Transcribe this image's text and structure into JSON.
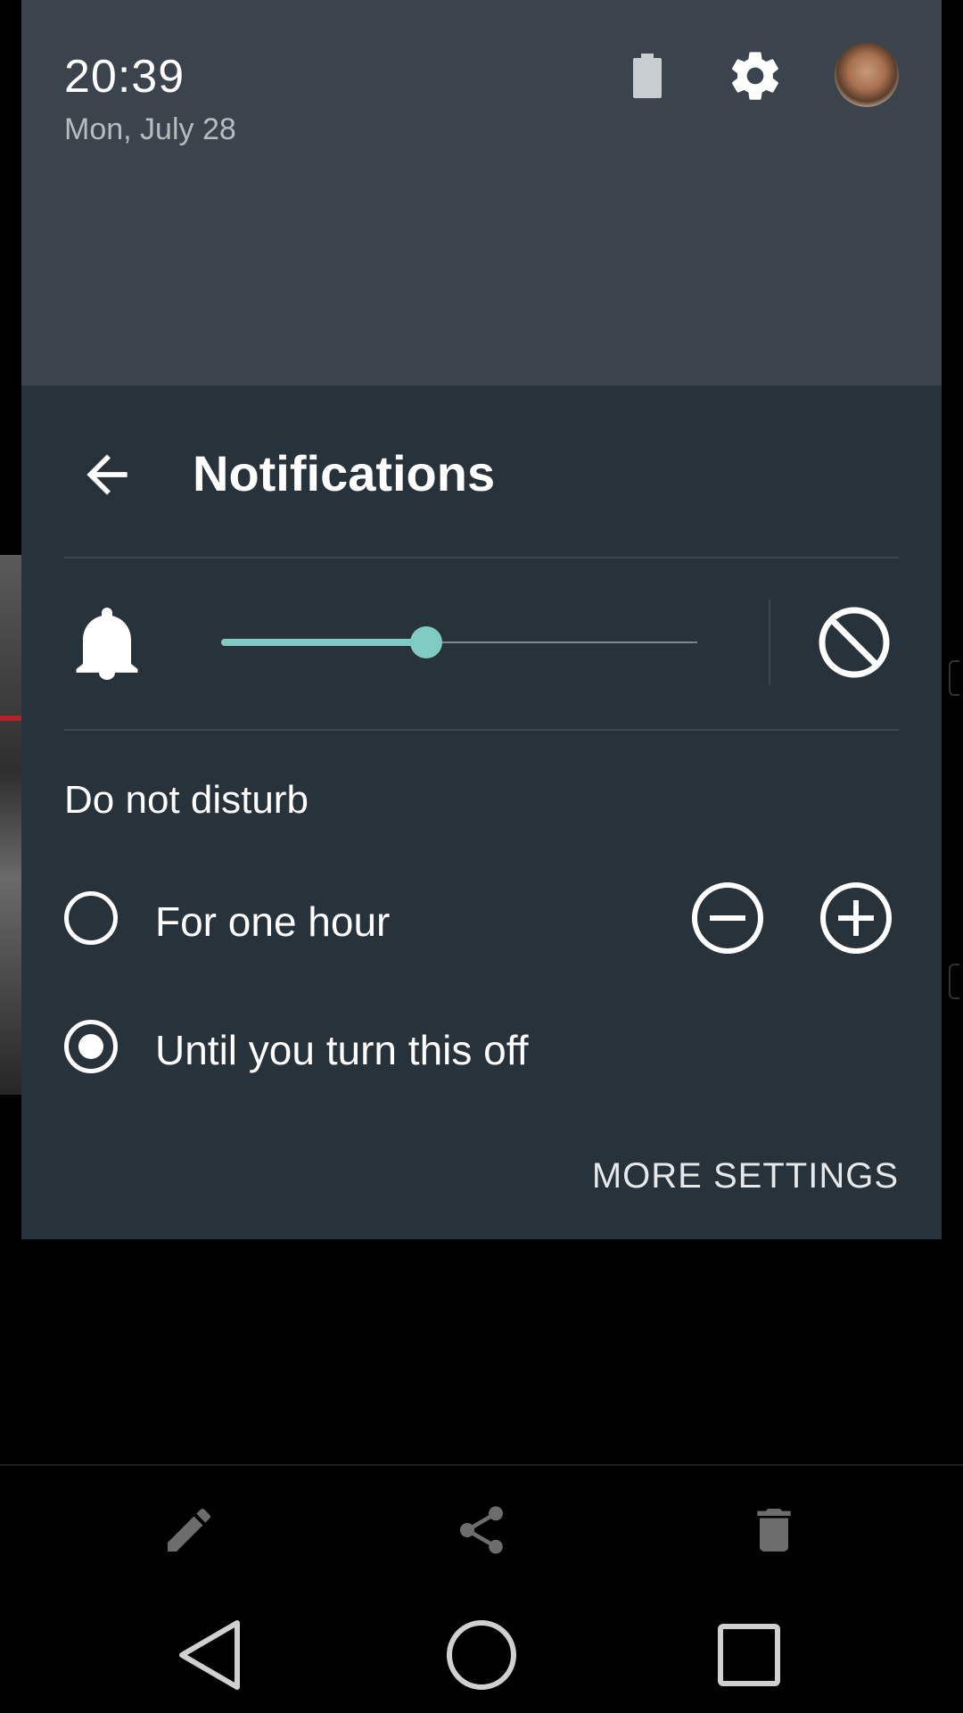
{
  "status_header": {
    "time": "20:39",
    "date": "Mon, July 28",
    "icons": [
      "battery-icon",
      "settings-gear-icon",
      "user-avatar"
    ]
  },
  "notifications_panel": {
    "title": "Notifications",
    "back_icon": "arrow-back-icon",
    "volume": {
      "icon": "bell-icon",
      "level": 0.43,
      "mute_icon": "block-icon"
    },
    "dnd": {
      "label": "Do not disturb",
      "options": [
        {
          "label": "For one hour",
          "selected": false
        },
        {
          "label": "Until you turn this off",
          "selected": true
        }
      ],
      "decrease_icon": "minus-circle-icon",
      "increase_icon": "plus-circle-icon"
    },
    "more_settings_label": "MORE SETTINGS"
  },
  "colors": {
    "header_bg": "#3b444c",
    "panel_bg": "#28323a",
    "accent": "#80cbc4"
  },
  "app_toolbar": {
    "icons": [
      "edit-pencil-icon",
      "share-icon",
      "delete-trash-icon"
    ]
  },
  "navigation_bar": {
    "icons": [
      "back-triangle-icon",
      "home-circle-icon",
      "recents-square-icon"
    ]
  }
}
